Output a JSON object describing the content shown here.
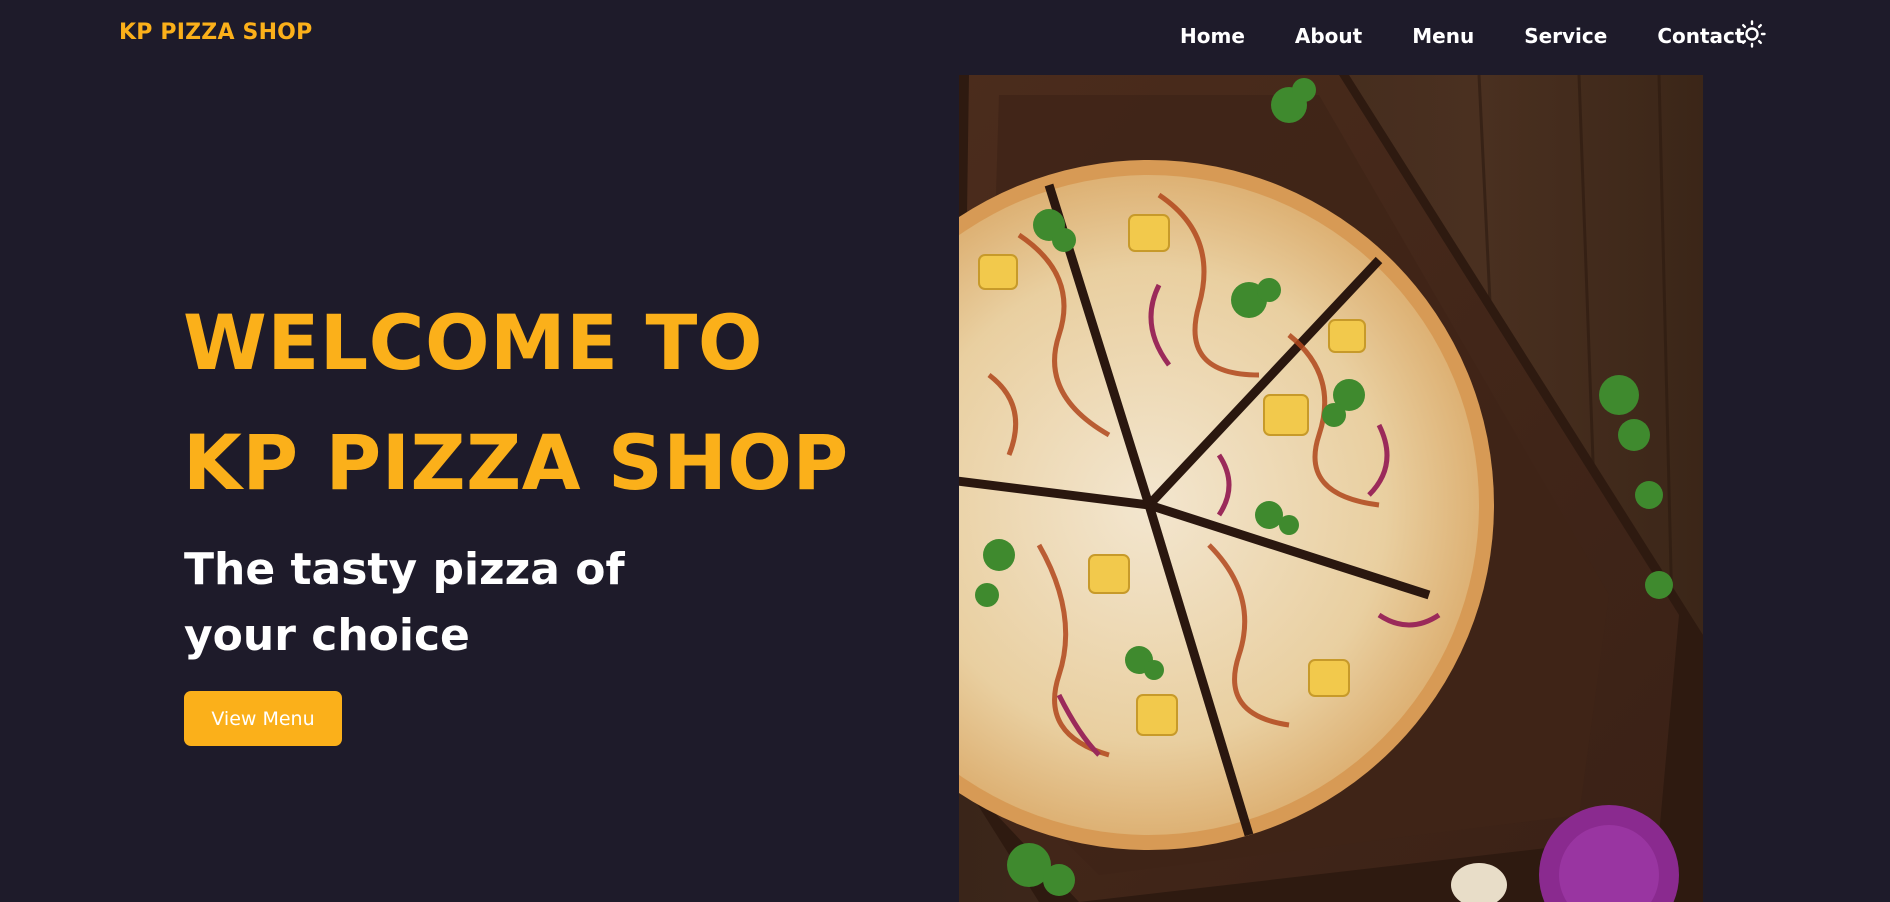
{
  "brand": {
    "logo_text": "KP PIZZA SHOP",
    "accent_color": "#fbb01a",
    "background_color": "#1e1b2a"
  },
  "nav": {
    "links": [
      {
        "label": "Home"
      },
      {
        "label": "About"
      },
      {
        "label": "Menu"
      },
      {
        "label": "Service"
      },
      {
        "label": "Contact"
      }
    ],
    "theme_toggle_icon": "sun-icon"
  },
  "hero": {
    "title": "WELCOME TO KP PIZZA SHOP",
    "subtitle": "The tasty pizza of your choice",
    "cta_label": "View Menu",
    "image_subject": "pizza-on-wooden-board"
  }
}
